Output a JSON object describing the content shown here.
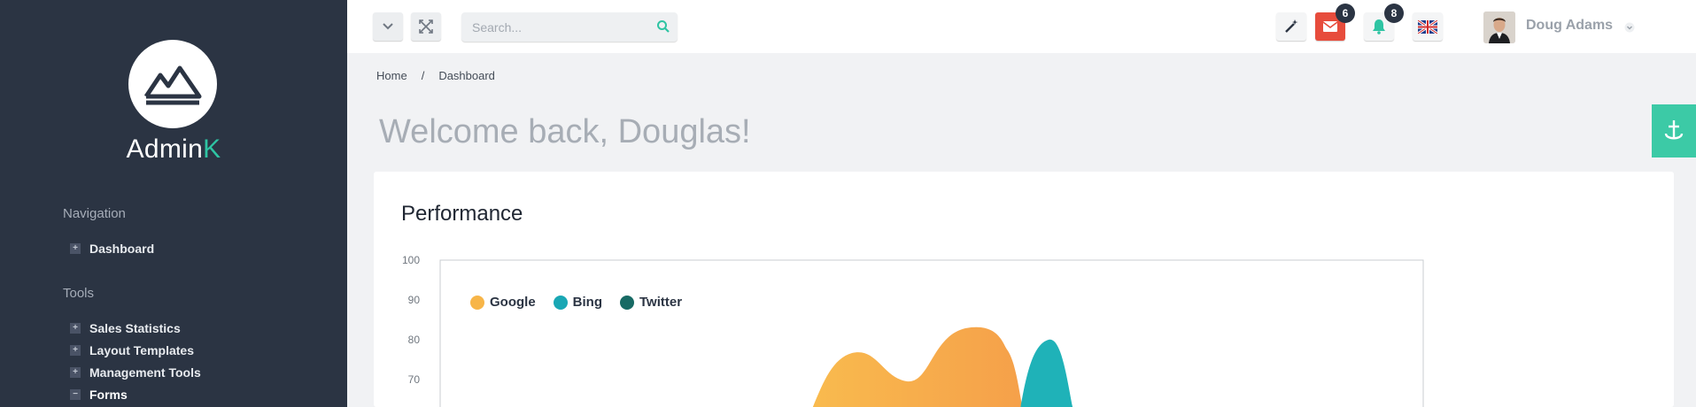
{
  "sidebar": {
    "brand_main": "Admin",
    "brand_accent": "K",
    "sections": [
      {
        "label": "Navigation",
        "items": [
          {
            "label": "Dashboard",
            "expanded": false
          }
        ]
      },
      {
        "label": "Tools",
        "items": [
          {
            "label": "Sales Statistics",
            "expanded": false
          },
          {
            "label": "Layout Templates",
            "expanded": false
          },
          {
            "label": "Management Tools",
            "expanded": false
          },
          {
            "label": "Forms",
            "expanded": true
          }
        ]
      }
    ]
  },
  "topbar": {
    "search_placeholder": "Search...",
    "mail_count": "6",
    "notification_count": "8",
    "user_name": "Doug Adams"
  },
  "breadcrumb": {
    "home": "Home",
    "separator": "/",
    "current": "Dashboard"
  },
  "page_title": "Welcome back, Douglas!",
  "colors": {
    "sidebar_bg": "#2b3443",
    "accent": "#2ec4a3",
    "google": "#f7b548",
    "bing": "#19a7b4",
    "twitter": "#176a64",
    "mail_button": "#e74c3c",
    "bell": "#2ec4a3"
  },
  "chart_data": {
    "type": "area",
    "title": "Performance",
    "ylim": [
      60,
      100
    ],
    "yticks": [
      100,
      90,
      80,
      70
    ],
    "legend_position": "top-left",
    "series": [
      {
        "name": "Google",
        "color": "#f7b548"
      },
      {
        "name": "Bing",
        "color": "#19a7b4"
      },
      {
        "name": "Twitter",
        "color": "#176a64"
      }
    ]
  }
}
